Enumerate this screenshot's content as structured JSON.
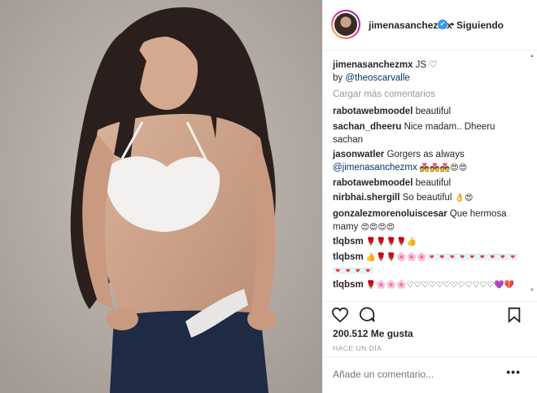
{
  "header": {
    "username": "jimenasanchezmx",
    "separator": "•",
    "follow_status": "Siguiendo"
  },
  "caption": {
    "username": "jimenasanchezmx",
    "text": " JS ♡",
    "by": "by ",
    "mention": "@theoscarvalle"
  },
  "load_more": "Cargar más comentarios",
  "comments": [
    {
      "user": "rabotawebmoodel",
      "text": " beautiful",
      "emoji": ""
    },
    {
      "user": "sachan_dheeru",
      "text": " Nice madam.. Dheeru sachan",
      "emoji": ""
    },
    {
      "user": "jasonwatler",
      "text": " Gorgers as always ",
      "mention": "@jimenasanchezmx",
      "emoji": "💑💑💑😍😍"
    },
    {
      "user": "rabotawebmoodel",
      "text": " beautiful",
      "emoji": ""
    },
    {
      "user": "nirbhai.shergill",
      "text": " So beautiful ",
      "emoji": "👌😍"
    },
    {
      "user": "gonzalezmorenoluiscesar",
      "text": " Que hermosa mamy ",
      "emoji": "😍😍😍😍"
    },
    {
      "user": "tlqbsm",
      "text": " ",
      "emoji": "🌹🌹🌹🌹👍"
    },
    {
      "user": "tlqbsm",
      "text": " ",
      "emoji": "👍🌹🌹🌸🌸🌸💌💌💌💌💌💌💌💌💌💌💌💌💌"
    },
    {
      "user": "tlqbsm",
      "text": " ",
      "emoji": "🌹🌸🌸🌸♡♡♡♡♡♡♡♡♡♡♡♡💜💔"
    }
  ],
  "likes": "200.512 Me gusta",
  "time_ago": "HACE UN DÍA",
  "add_comment": {
    "placeholder": "Añade un comentario...",
    "more": "•••"
  },
  "colors": {
    "verified": "#3897f0",
    "mention": "#003569",
    "muted": "#999999",
    "border": "#efefef"
  }
}
